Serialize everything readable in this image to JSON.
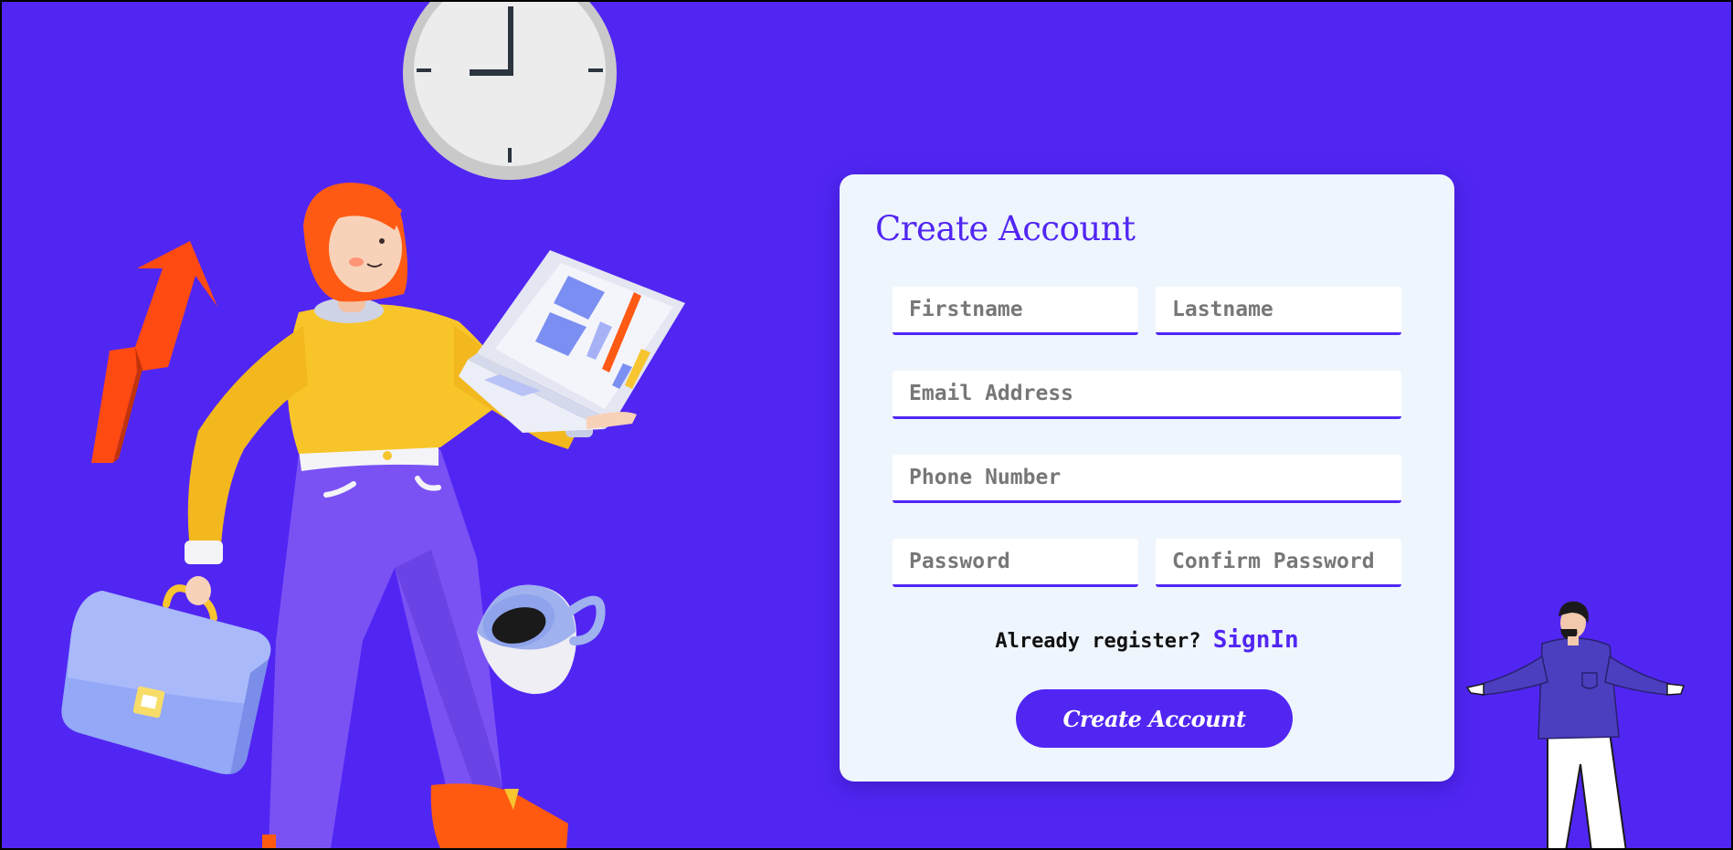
{
  "colors": {
    "background": "#5126f3",
    "card": "#eef5fd",
    "accent": "#5126f3",
    "button_text": "#ffffff"
  },
  "illustration": {
    "woman": "woman-holding-laptop-and-briefcase",
    "icons": [
      "clock-icon",
      "growth-arrow-icon",
      "briefcase-icon",
      "coffee-mug-icon",
      "laptop-icon"
    ],
    "man": "man-shrugging"
  },
  "form": {
    "title": "Create Account",
    "fields": {
      "firstname": {
        "placeholder": "Firstname"
      },
      "lastname": {
        "placeholder": "Lastname"
      },
      "email": {
        "placeholder": "Email Address"
      },
      "phone": {
        "placeholder": "Phone Number"
      },
      "password": {
        "placeholder": "Password"
      },
      "confirm_password": {
        "placeholder": "Confirm Password"
      }
    },
    "signin_prompt": "Already register?",
    "signin_link": "SignIn",
    "submit_label": "Create Account"
  }
}
